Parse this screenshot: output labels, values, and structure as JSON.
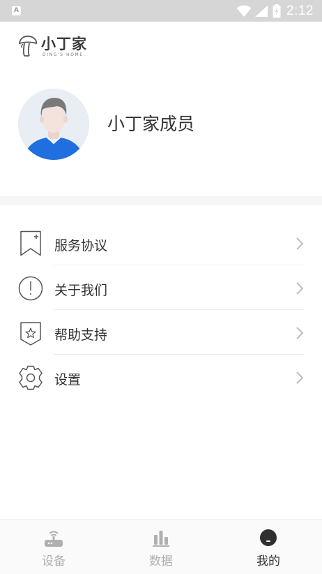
{
  "status_bar": {
    "notification_icon": "A",
    "time": "2:12",
    "icons": [
      "wifi-icon",
      "signal-icon",
      "battery-icon"
    ]
  },
  "header": {
    "logo_cn": "小丁家",
    "logo_en": "DING'S HOME"
  },
  "profile": {
    "name": "小丁家成员"
  },
  "menu": {
    "items": [
      {
        "label": "服务协议",
        "icon": "bookmark-plus-icon"
      },
      {
        "label": "关于我们",
        "icon": "info-circle-icon"
      },
      {
        "label": "帮助支持",
        "icon": "shield-star-icon"
      },
      {
        "label": "设置",
        "icon": "gear-icon"
      }
    ]
  },
  "bottom_nav": {
    "items": [
      {
        "label": "设备",
        "icon": "router-icon",
        "active": false
      },
      {
        "label": "数据",
        "icon": "bar-chart-icon",
        "active": false
      },
      {
        "label": "我的",
        "icon": "profile-icon",
        "active": true
      }
    ]
  },
  "colors": {
    "status_bar_bg": "#d6d6d6",
    "text_primary": "#333333",
    "nav_inactive": "#b0b0b0",
    "avatar_shirt": "#1f6fe0"
  }
}
